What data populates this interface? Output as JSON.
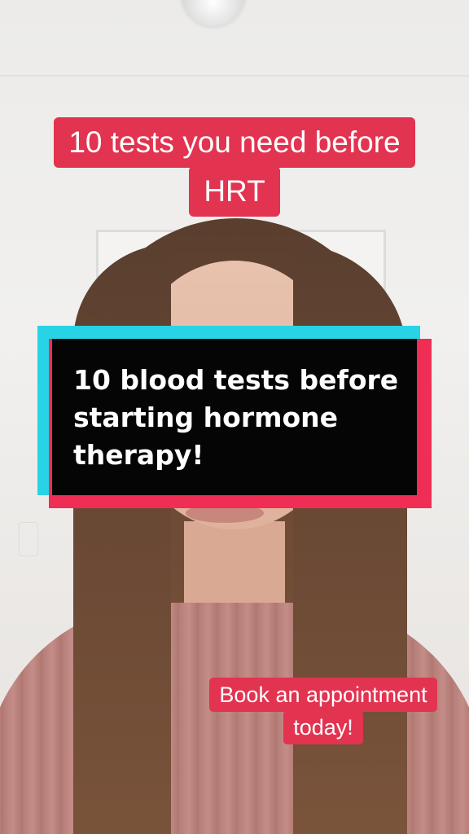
{
  "captions": {
    "title_line1": "10 tests you need before",
    "title_line2": "HRT"
  },
  "card": {
    "text": "10 blood tests before starting hormone therapy!"
  },
  "cta": {
    "line1": "Book an appointment",
    "line2": "today!"
  },
  "colors": {
    "caption_bg": "#e23350",
    "card_cyan": "#27d3e4",
    "card_red": "#f02d55",
    "card_black": "#050505"
  }
}
